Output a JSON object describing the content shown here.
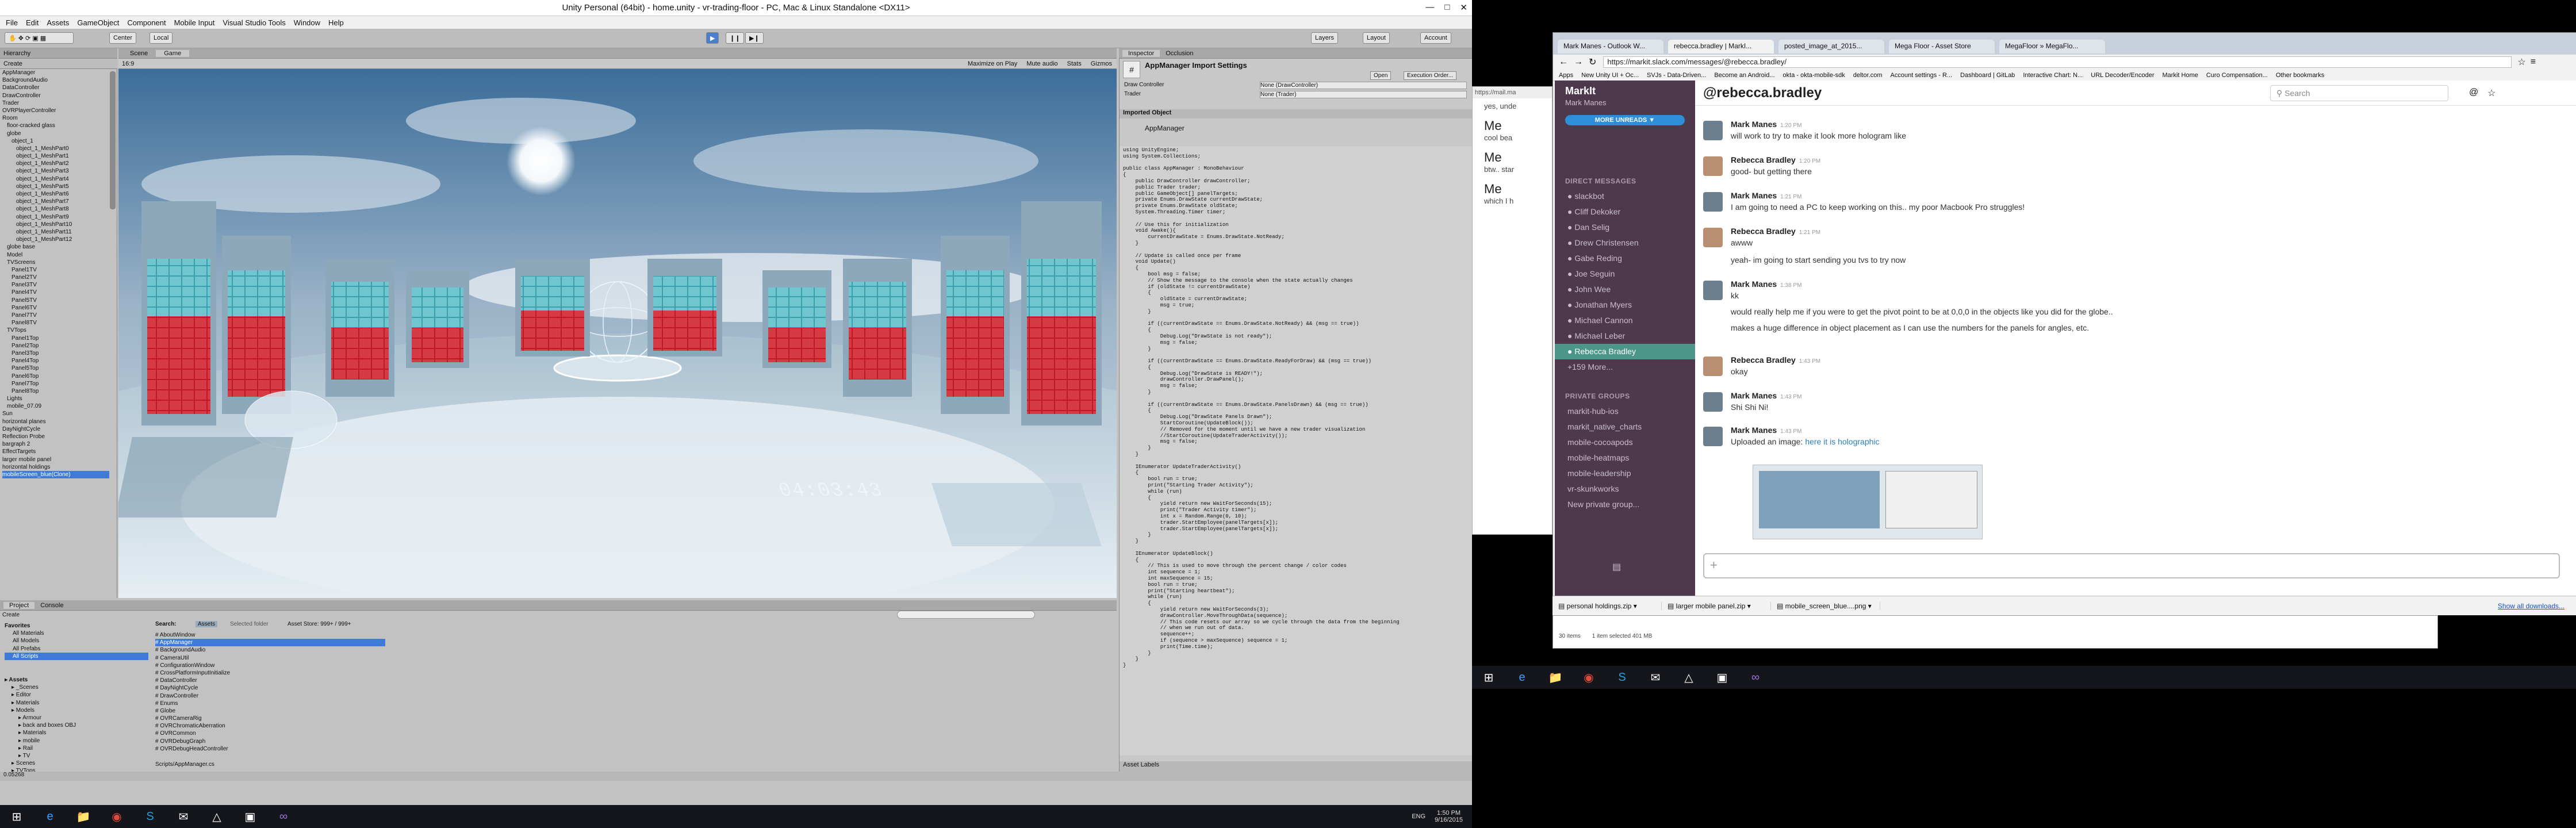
{
  "unity": {
    "title": "Unity Personal (64bit) - home.unity - vr-trading-floor - PC, Mac & Linux Standalone <DX11>",
    "menu": [
      "File",
      "Edit",
      "Assets",
      "GameObject",
      "Component",
      "Mobile Input",
      "Visual Studio Tools",
      "Window",
      "Help"
    ],
    "toolbar": {
      "center": "Center",
      "local": "Local",
      "layers": "Layers",
      "layout": "Layout",
      "account": "Account"
    },
    "tabs": {
      "hierarchy": "Hierarchy",
      "scene": "Scene",
      "game": "Game",
      "inspector": "Inspector",
      "occlusion": "Occlusion",
      "project": "Project",
      "console": "Console"
    },
    "hierarchy_create": "Create",
    "hierarchy": [
      "AppManager",
      "BackgroundAudio",
      "DataController",
      "DrawController",
      "Trader",
      "OVRPlayerController",
      "Room",
      "floor-cracked glass",
      "globe",
      "object_1",
      "object_1_MeshPart0",
      "object_1_MeshPart1",
      "object_1_MeshPart2",
      "object_1_MeshPart3",
      "object_1_MeshPart4",
      "object_1_MeshPart5",
      "object_1_MeshPart6",
      "object_1_MeshPart7",
      "object_1_MeshPart8",
      "object_1_MeshPart9",
      "object_1_MeshPart10",
      "object_1_MeshPart11",
      "object_1_MeshPart12",
      "globe base",
      "Model",
      "TVScreens",
      "Panel1TV",
      "Panel2TV",
      "Panel3TV",
      "Panel4TV",
      "Panel5TV",
      "Panel6TV",
      "Panel7TV",
      "Panel8TV",
      "TVTops",
      "Panel1Top",
      "Panel2Top",
      "Panel3Top",
      "Panel4Top",
      "Panel5Top",
      "Panel6Top",
      "Panel7Top",
      "Panel8Top",
      "Lights",
      "mobile_07.09",
      "Sun",
      "horizontal planes",
      "DayNightCycle",
      "Reflection Probe",
      "bargraph 2",
      "EffectTargets",
      "larger mobile panel",
      "horizontal holdings",
      "mobileScreen_blue(Clone)"
    ],
    "game_view": {
      "maximize": "Maximize on Play",
      "mute": "Mute audio",
      "stats": "Stats",
      "gizmos": "Gizmos",
      "aspect": "16:9",
      "timer": "04:03:43"
    },
    "inspector": {
      "header": "AppManager Import Settings",
      "open": "Open",
      "exec_order": "Execution Order...",
      "fields": [
        {
          "label": "Draw Controller",
          "value": "None (DrawController)"
        },
        {
          "label": "Trader",
          "value": "None (Trader)"
        }
      ],
      "imported": "Imported Object",
      "script_name": "AppManager",
      "asset_labels": "Asset Labels"
    },
    "code": "using UnityEngine;\nusing System.Collections;\n\npublic class AppManager : MonoBehaviour\n{\n    public DrawController drawController;\n    public Trader trader;\n    public GameObject[] panelTargets;\n    private Enums.DrawState currentDrawState;\n    private Enums.DrawState oldState;\n    System.Threading.Timer timer;\n\n    // Use this for initialization\n    void Awake(){\n        currentDrawState = Enums.DrawState.NotReady;\n    }\n\n    // Update is called once per frame\n    void Update()\n    {\n        bool msg = false;\n        // Show the message to the console when the state actually changes\n        if (oldState != currentDrawState)\n        {\n            oldState = currentDrawState;\n            msg = true;\n        }\n\n        if ((currentDrawState == Enums.DrawState.NotReady) && (msg == true))\n        {\n            Debug.Log(\"DrawState is not ready\");\n            msg = false;\n        }\n\n        if ((currentDrawState == Enums.DrawState.ReadyForDraw) && (msg == true))\n        {\n            Debug.Log(\"DrawState is READY!\");\n            drawController.DrawPanel();\n            msg = false;\n        }\n\n        if ((currentDrawState == Enums.DrawState.PanelsDrawn) && (msg == true))\n        {\n            Debug.Log(\"DrawState Panels Drawn\");\n            StartCoroutine(UpdateBlock());\n            // Removed for the moment until we have a new trader visualization\n            //StartCoroutine(UpdateTraderActivity());\n            msg = false;\n        }\n    }\n\n    IEnumerator UpdateTraderActivity()\n    {\n        bool run = true;\n        print(\"Starting Trader Activity\");\n        while (run)\n        {\n            yield return new WaitForSeconds(15);\n            print(\"Trader Activity timer\");\n            int x = Random.Range(0, 10);\n            trader.StartEmployee(panelTargets[x]);\n            trader.StartEmployee(panelTargets[x]);\n        }\n    }\n\n    IEnumerator UpdateBlock()\n    {\n        // This is used to move through the percent change / color codes\n        int sequence = 1;\n        int maxSequence = 15;\n        bool run = true;\n        print(\"Starting heartbeat\");\n        while (run)\n        {\n            yield return new WaitForSeconds(3);\n            drawController.MoveThroughData(sequence);\n            // This code resets our array so we cycle through the data from the beginning\n            // when we run out of data.\n            sequence++;\n            if (sequence > maxSequence) sequence = 1;\n            print(Time.time);\n        }\n    }\n}",
    "project": {
      "create": "Create",
      "search_label": "Search:",
      "assets_tab": "Assets",
      "selected_folder": "Selected folder",
      "asset_store": "Asset Store: 999+ / 999+",
      "favorites": [
        "Favorites",
        "All Materials",
        "All Models",
        "All Prefabs",
        "All Scripts"
      ],
      "folders": [
        "Assets",
        "_Scenes",
        "Editor",
        "Materials",
        "Models",
        "Armour",
        "back and boxes OBJ",
        "Materials",
        "mobile",
        "Rail",
        "TV",
        "Scenes",
        "TVTops"
      ],
      "files": [
        "AboutWindow",
        "AppManager",
        "BackgroundAudio",
        "CameraUtil",
        "ConfigurationWindow",
        "CrossPlatformInputInitialize",
        "DataController",
        "DayNightCycle",
        "DrawController",
        "Enums",
        "Globe",
        "OVRCameraRig",
        "OVRChromaticAberration",
        "OVRCommon",
        "OVRDebugGraph",
        "OVRDebugHeadController"
      ],
      "footer": "Scripts/AppManager.cs"
    },
    "status": "0.05268"
  },
  "taskbar_left": {
    "time": "1:50 PM",
    "date": "9/16/2015",
    "lang": "ENG"
  },
  "chrome": {
    "tabs": [
      "Mark Manes - Outlook W...",
      "rebecca.bradley | MarkI...",
      "posted_image_at_2015...",
      "Mega Floor - Asset Store",
      "MegaFloor » MegaFlo..."
    ],
    "url": "https://markit.slack.com/messages/@rebecca.bradley/",
    "bookmarks": [
      "Apps",
      "New Unity UI + Oc...",
      "SVJs - Data-Driven...",
      "Become an Android...",
      "okta - okta-mobile-sdk",
      "deltor.com",
      "Account settings - R...",
      "Dashboard | GitLab",
      "Interactive Chart: N...",
      "URL Decoder/Encoder",
      "Markit Home",
      "Curo Compensation...",
      "Other bookmarks"
    ],
    "downloads": [
      "personal holdings.zip",
      "larger mobile panel.zip",
      "mobile_screen_blue....png"
    ],
    "show_all": "Show all downloads..."
  },
  "slack": {
    "team": "MarkIt",
    "user": "Mark Manes",
    "more_unreads": "MORE UNREADS",
    "dm_header": "DIRECT MESSAGES",
    "dms": [
      "slackbot",
      "Cliff Dekoker",
      "Dan Selig",
      "Drew Christensen",
      "Gabe Reding",
      "Joe Seguin",
      "John Wee",
      "Jonathan Myers",
      "Michael Cannon",
      "Michael Leber",
      "Rebecca Bradley",
      "+159 More..."
    ],
    "groups_header": "PRIVATE GROUPS",
    "groups": [
      "markit-hub-ios",
      "markit_native_charts",
      "mobile-cocoapods",
      "mobile-heatmaps",
      "mobile-leadership",
      "vr-skunkworks",
      "New private group..."
    ],
    "channel": "@rebecca.bradley",
    "search": "Search",
    "messages": [
      {
        "author": "Mark Manes",
        "time": "1:20 PM",
        "text": "will work to try to make it look more hologram like"
      },
      {
        "author": "Rebecca Bradley",
        "time": "1:20 PM",
        "text": "good- but getting there"
      },
      {
        "author": "Mark Manes",
        "time": "1:21 PM",
        "text": "I am going to need a PC to keep working on this.. my poor Macbook Pro struggles!"
      },
      {
        "author": "Rebecca Bradley",
        "time": "1:21 PM",
        "text": "awww"
      },
      {
        "author": "",
        "time": "",
        "text": "yeah- im going to start sending you tvs to try now"
      },
      {
        "author": "Mark Manes",
        "time": "1:38 PM",
        "text": "kk"
      },
      {
        "author": "",
        "time": "",
        "text": "would really help me if you were to get the pivot point to be at 0,0,0 in the objects like you did for the globe.."
      },
      {
        "author": "",
        "time": "",
        "text": "makes a huge difference in object placement as I can use the numbers for the panels for angles, etc."
      },
      {
        "author": "Rebecca Bradley",
        "time": "1:43 PM",
        "text": "okay"
      },
      {
        "author": "Mark Manes",
        "time": "1:43 PM",
        "text": "Shi Shi Ni!"
      },
      {
        "author": "Mark Manes",
        "time": "1:43 PM",
        "text": "Uploaded an image:"
      }
    ],
    "image_link": "here it is holographic",
    "outlook_snips": [
      "yes, unde",
      "Me",
      "cool bea",
      "Me",
      "btw.. star",
      "Me",
      "which I h"
    ],
    "outlook_url": "https://mail.ma",
    "explorer": {
      "items": "30 items",
      "selected": "1 item selected 401 MB"
    }
  },
  "colors": {
    "slack_sidebar": "#4d394b",
    "slack_active": "#4c9689",
    "unity_bg": "#c2c2c2",
    "selection": "#3d7bd6"
  }
}
